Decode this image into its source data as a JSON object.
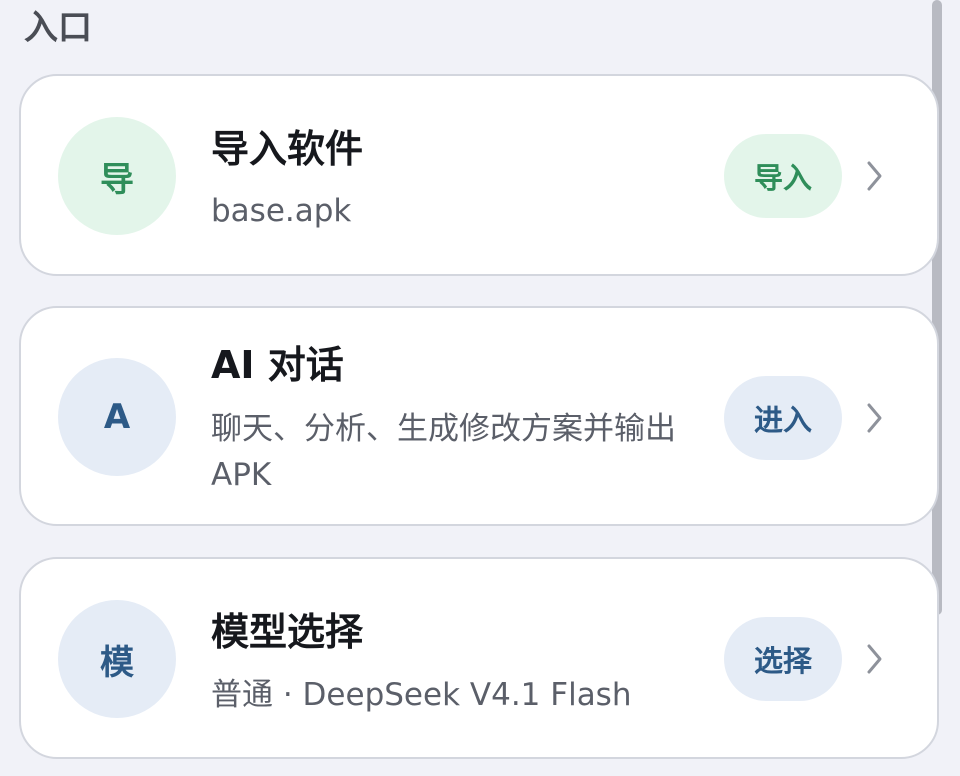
{
  "section": {
    "title": "入口"
  },
  "cards": [
    {
      "avatar": "导",
      "title": "导入软件",
      "subtitle": "base.apk",
      "action": "导入",
      "chevron_icon": "chevron-right-icon",
      "accent": "#2f8e5a"
    },
    {
      "avatar": "A",
      "title": "AI 对话",
      "subtitle": "聊天、分析、生成修改方案并输出 APK",
      "action": "进入",
      "chevron_icon": "chevron-right-icon",
      "accent": "#2d5a87"
    },
    {
      "avatar": "模",
      "title": "模型选择",
      "subtitle": "普通 · DeepSeek V4.1 Flash",
      "action": "选择",
      "chevron_icon": "chevron-right-icon",
      "accent": "#2d5a87"
    }
  ]
}
